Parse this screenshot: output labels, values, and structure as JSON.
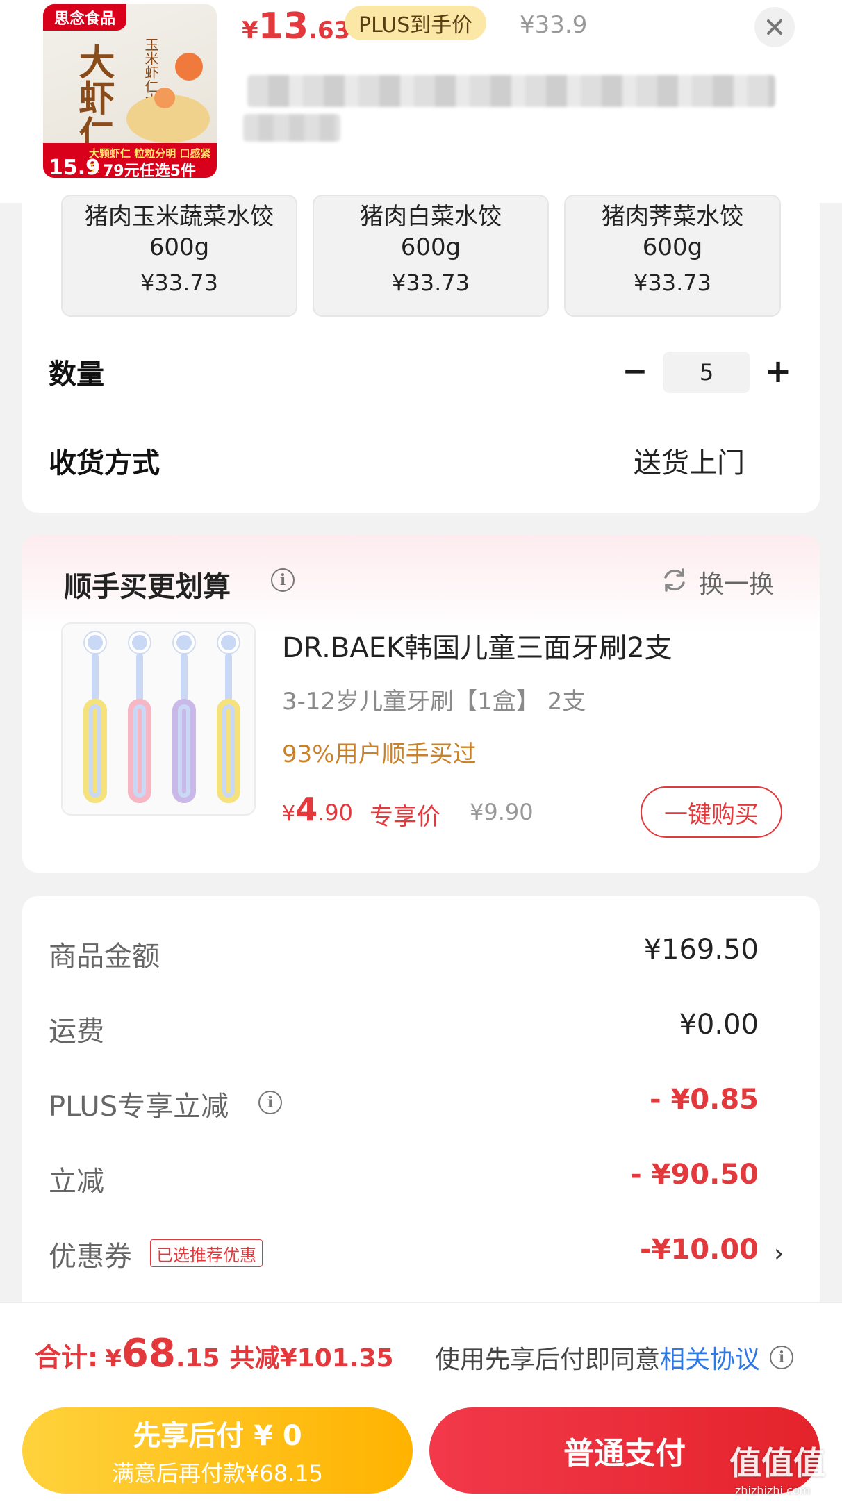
{
  "product": {
    "thumb_brand": "思念食品",
    "thumb_title": "大虾仁",
    "thumb_subtitle": "玉米虾仁水饺",
    "thumb_banner_text": "大颗虾仁 粒粒分明 口感紧实",
    "thumb_banner_price": "15.9",
    "thumb_banner_promo": "79元任选5件",
    "price_currency": "¥",
    "price_int": "13",
    "price_dec": ".63",
    "plus_badge": "PLUS到手价",
    "original_price": "¥33.9",
    "close_icon": "close-icon"
  },
  "variants": [
    {
      "name": "猪肉玉米蔬菜水饺600g",
      "price": "¥33.73"
    },
    {
      "name": "猪肉白菜水饺600g",
      "price": "¥33.73"
    },
    {
      "name": "猪肉荠菜水饺600g",
      "price": "¥33.73"
    }
  ],
  "quantity": {
    "label": "数量",
    "value": "5",
    "minus": "−",
    "plus": "+"
  },
  "shipping": {
    "label": "收货方式",
    "value": "送货上门"
  },
  "addon": {
    "title": "顺手买更划算",
    "info_icon": "i",
    "swap_label": "换一换",
    "name": "DR.BAEK韩国儿童三面牙刷2支",
    "spec": "3-12岁儿童牙刷【1盒】 2支",
    "social_proof": "93%用户顺手买过",
    "price_currency": "¥",
    "price_int": "4",
    "price_dec": ".90",
    "exclusive_label": "专享价",
    "original_price": "¥9.90",
    "buy_button": "一键购买",
    "brush_colors": [
      "#f5e27a",
      "#f6b6c4",
      "#c9b8e8",
      "#f5e27a"
    ]
  },
  "summary": {
    "rows": [
      {
        "label": "商品金额",
        "value": "¥169.50"
      },
      {
        "label": "运费",
        "value": "¥0.00"
      },
      {
        "label": "PLUS专享立减",
        "value": "- ¥0.85"
      },
      {
        "label": "立减",
        "value": "- ¥90.50"
      },
      {
        "label": "优惠券",
        "value": "-¥10.00"
      }
    ],
    "coupon_tag": "已选推荐优惠",
    "chevron": "›"
  },
  "total": {
    "label": "合计:",
    "currency": "¥",
    "int": "68",
    "dec": ".15",
    "savings": "共减¥101.35",
    "agree_text": "使用先享后付即同意",
    "agree_link": "相关协议"
  },
  "buttons": {
    "later_line1": "先享后付 ¥ 0",
    "later_line2": "满意后再付款¥68.15",
    "pay": "普通支付"
  },
  "watermark": {
    "text": "值值值",
    "sub": "zhizhizhi.com"
  },
  "colors": {
    "accent_red": "#e4393c",
    "plus_gold": "#fbe7a6",
    "later_yellow": "#ffb300",
    "link_blue": "#2f79e6"
  }
}
